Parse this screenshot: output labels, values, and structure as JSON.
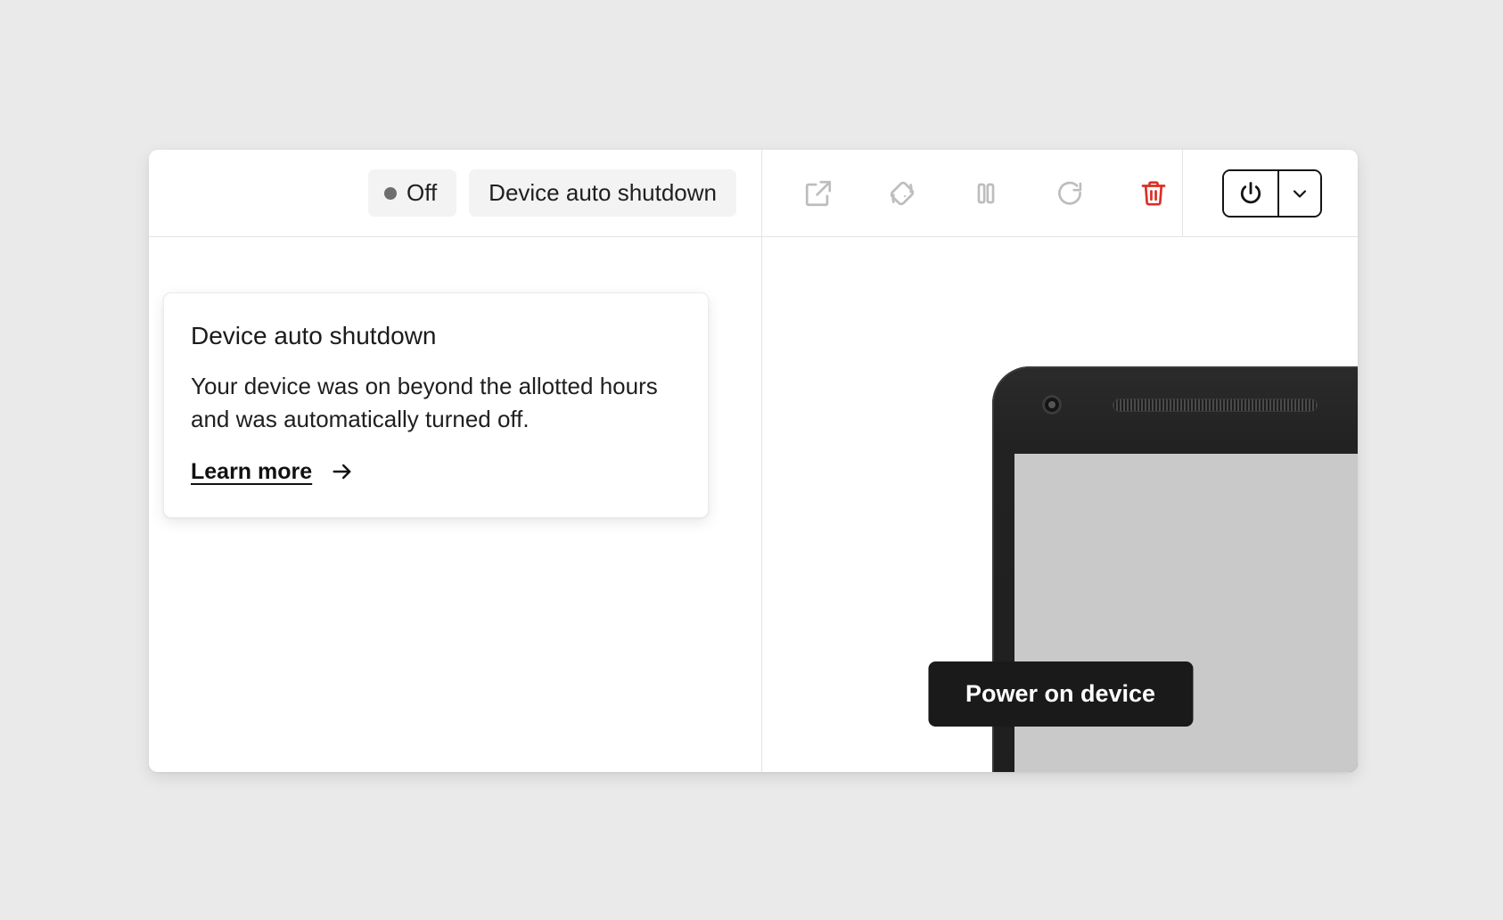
{
  "header": {
    "status": {
      "dot_color": "#6e6e6e",
      "label": "Off"
    },
    "reason_chip": "Device auto shutdown",
    "tools": [
      {
        "name": "external-link-icon",
        "tooltip": "Open in new window"
      },
      {
        "name": "rotate-device-icon",
        "tooltip": "Rotate device"
      },
      {
        "name": "pause-icon",
        "tooltip": "Pause"
      },
      {
        "name": "refresh-icon",
        "tooltip": "Restart"
      },
      {
        "name": "trash-icon",
        "tooltip": "Delete",
        "color": "#d93025"
      }
    ],
    "power": {
      "button_label": "Power",
      "caret_label": "More power options"
    }
  },
  "popover": {
    "title": "Device auto shutdown",
    "body": "Your device was on beyond the allotted hours and was automatically turned off.",
    "learn_more": "Learn more",
    "arrow": "arrow-right-icon"
  },
  "device_panel": {
    "power_on_label": "Power on device",
    "screen_color": "#c9c9c9",
    "frame_color": "#222222"
  },
  "theme": {
    "page_background": "#eaeaea",
    "card_background": "#ffffff",
    "border": "#e4e4e4",
    "icon_gray": "#bdbdbd",
    "text_primary": "#1f1f1f",
    "danger": "#d93025",
    "accent_dark": "#1a1a1a"
  }
}
